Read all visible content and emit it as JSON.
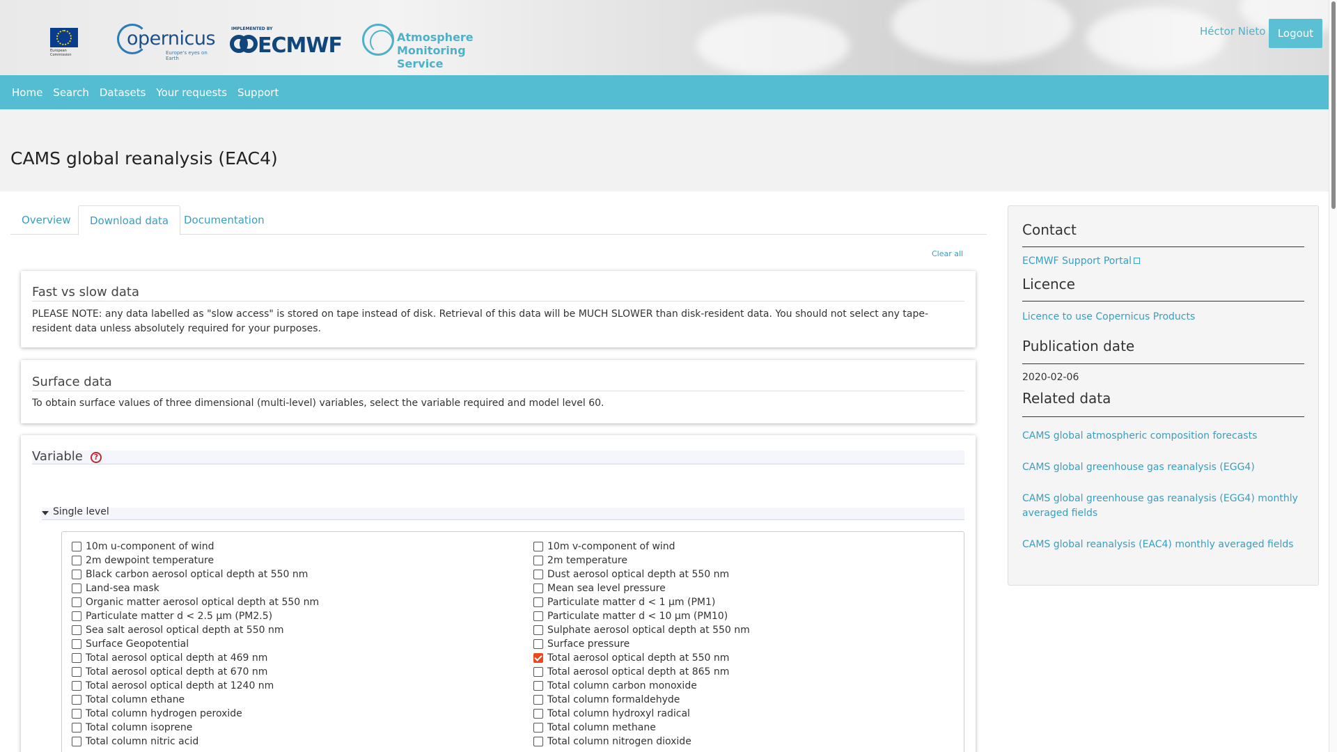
{
  "header": {
    "eu_caption": "European Commission",
    "copernicus_text": "opernicus",
    "copernicus_tagline": "Europe's eyes on Earth",
    "ecmwf_impl": "IMPLEMENTED BY",
    "ecmwf_text": "ECMWF",
    "atmos_line1": "Atmosphere",
    "atmos_line2": "Monitoring Service",
    "user_name": "Héctor Nieto",
    "logout_label": "Logout"
  },
  "nav": {
    "items": [
      "Home",
      "Search",
      "Datasets",
      "Your requests",
      "Support"
    ]
  },
  "page": {
    "title": "CAMS global reanalysis (EAC4)"
  },
  "tabs": [
    "Overview",
    "Download data",
    "Documentation"
  ],
  "clear_all": "Clear all",
  "fast_slow": {
    "title": "Fast vs slow data",
    "text": "PLEASE NOTE: any data labelled as \"slow access\" is stored on tape instead of disk. Retrieval of this data will be MUCH SLOWER than disk-resident data. You should not select any tape-resident data unless absolutely required for your purposes."
  },
  "surface": {
    "title": "Surface data",
    "text": "To obtain surface values of three dimensional (multi-level) variables, select the variable required and model level 60."
  },
  "variable": {
    "title": "Variable",
    "help": "?",
    "group_label": "Single level",
    "left_column": [
      "10m u-component of wind",
      "2m dewpoint temperature",
      "Black carbon aerosol optical depth at 550 nm",
      "Land-sea mask",
      "Organic matter aerosol optical depth at 550 nm",
      "Particulate matter d < 2.5 µm (PM2.5)",
      "Sea salt aerosol optical depth at 550 nm",
      "Surface Geopotential",
      "Total aerosol optical depth at 469 nm",
      "Total aerosol optical depth at 670 nm",
      "Total aerosol optical depth at 1240 nm",
      "Total column ethane",
      "Total column hydrogen peroxide",
      "Total column isoprene",
      "Total column nitric acid"
    ],
    "right_column": [
      "10m v-component of wind",
      "2m temperature",
      "Dust aerosol optical depth at 550 nm",
      "Mean sea level pressure",
      "Particulate matter d < 1 µm (PM1)",
      "Particulate matter d < 10 µm (PM10)",
      "Sulphate aerosol optical depth at 550 nm",
      "Surface pressure",
      "Total aerosol optical depth at 550 nm",
      "Total aerosol optical depth at 865 nm",
      "Total column carbon monoxide",
      "Total column formaldehyde",
      "Total column hydroxyl radical",
      "Total column methane",
      "Total column nitrogen dioxide"
    ],
    "checked": [
      "Total aerosol optical depth at 550 nm"
    ]
  },
  "sidebar": {
    "contact_heading": "Contact",
    "contact_link": "ECMWF Support Portal",
    "licence_heading": "Licence",
    "licence_link": "Licence to use Copernicus Products",
    "pubdate_heading": "Publication date",
    "pubdate_value": "2020-02-06",
    "related_heading": "Related data",
    "related_links": [
      "CAMS global atmospheric composition forecasts",
      "CAMS global greenhouse gas reanalysis (EGG4)",
      "CAMS global greenhouse gas reanalysis (EGG4) monthly averaged fields",
      "CAMS global reanalysis (EAC4) monthly averaged fields"
    ]
  },
  "colors": {
    "nav_bg": "#55bdd1",
    "link": "#3a9ec0",
    "checkbox_checked": "#e8491d",
    "help_icon": "#c1272d"
  }
}
